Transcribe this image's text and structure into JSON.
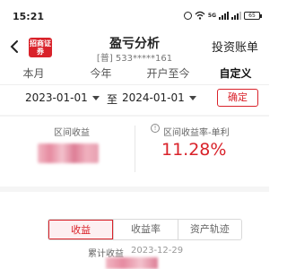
{
  "status_bar": {
    "time": "15:21",
    "network": "5G",
    "battery": "65"
  },
  "header": {
    "logo_text": "招商证券",
    "title": "盈亏分析",
    "account_masked": "[普] 533*****161",
    "account_link": "投资账单"
  },
  "tabs": [
    {
      "label": "本月",
      "active": false
    },
    {
      "label": "今年",
      "active": false
    },
    {
      "label": "开户至今",
      "active": false
    },
    {
      "label": "自定义",
      "active": true
    }
  ],
  "date_range": {
    "start": "2023-01-01",
    "separator": "至",
    "end": "2024-01-01",
    "confirm_label": "确定"
  },
  "stats": {
    "interval_income_label": "区间收益",
    "interval_rate_label": "区间收益率-单利",
    "interval_rate_value": "11.28%"
  },
  "segments": [
    {
      "label": "收益",
      "active": true
    },
    {
      "label": "收益率",
      "active": false
    },
    {
      "label": "资产轨迹",
      "active": false
    }
  ],
  "cumulative": {
    "label": "累计收益",
    "date": "2023-12-29"
  },
  "colors": {
    "accent": "#d9222a"
  }
}
